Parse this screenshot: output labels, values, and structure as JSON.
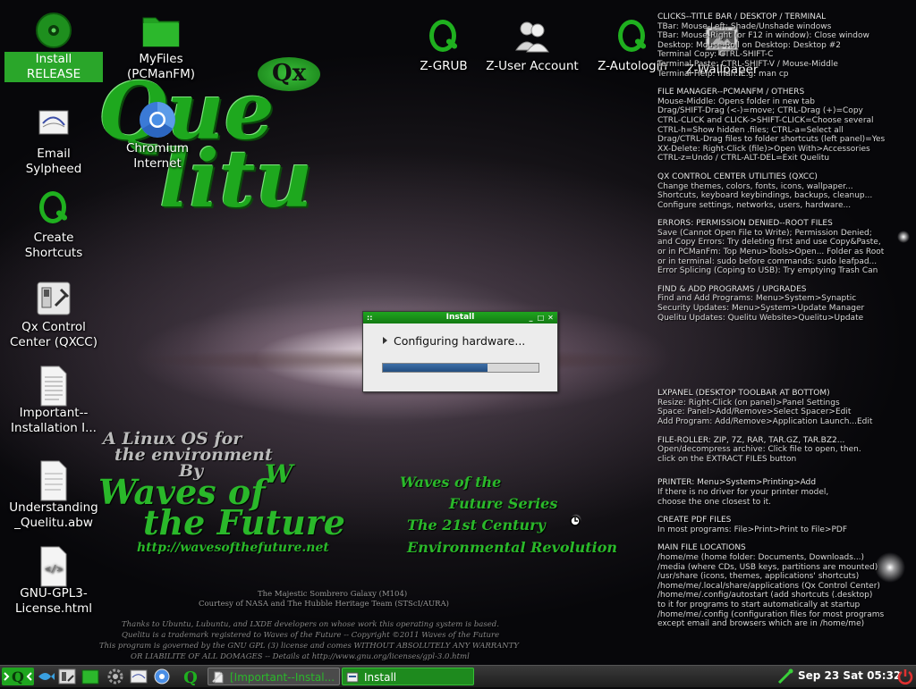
{
  "desktop_icons": [
    {
      "label": "Install RELEASE",
      "icon": "install-disc-icon"
    },
    {
      "label": "MyFiles (PCManFM)",
      "icon": "folder-icon"
    },
    {
      "label": "Email Sylpheed",
      "icon": "email-icon"
    },
    {
      "label": "Chromium Internet",
      "icon": "chromium-icon"
    },
    {
      "label": "Create Shortcuts",
      "icon": "q-icon"
    },
    {
      "label": "Qx Control Center (QXCC)",
      "icon": "control-center-icon"
    },
    {
      "label": "Important--Installation I...",
      "icon": "text-file-icon"
    },
    {
      "label": "Understanding _Quelitu.abw",
      "icon": "document-icon"
    },
    {
      "label": "GNU-GPL3-License.html",
      "icon": "html-file-icon"
    },
    {
      "label": "Z-GRUB",
      "icon": "q-icon"
    },
    {
      "label": "Z-User Account",
      "icon": "users-icon"
    },
    {
      "label": "Z-Autologin",
      "icon": "q-icon"
    },
    {
      "label": "Z-Wallpaper",
      "icon": "wallpaper-icon"
    }
  ],
  "wallpaper": {
    "logo_que": "Que",
    "logo_litu": "litu",
    "logo_badge": "Qx",
    "tagline_1": "A Linux OS for",
    "tagline_2": "the environment",
    "tagline_3": "By",
    "brand_1": "Waves of",
    "brand_2": "the Future",
    "brand_w": "W",
    "url": "http://wavesofthefuture.net",
    "series_1": "Waves of the",
    "series_2": "Future Series",
    "series_3": "The 21st Century",
    "series_4": "Environmental Revolution",
    "credit_1": "The Majestic Sombrero Galaxy (M104)",
    "credit_2": "Courtesy of NASA and The Hubble Heritage Team (STScI/AURA)",
    "footer_1": "Thanks to Ubuntu, Lubuntu, and LXDE developers on whose work this operating system is based.",
    "footer_2": "Quelitu is a trademark registered to Waves of the Future  --  Copyright ©2011  Waves of the Future",
    "footer_3": "This program is governed by the GNU GPL (3) license and comes WITHOUT ABSOLUTELY ANY WARRANTY",
    "footer_4": "OR LIABILITE OF ALL DOMAGES -- Details at http://www.gnu.org/licenses/gpl-3.0.html"
  },
  "info_panel": [
    {
      "title": "CLICKS--TITLE BAR / DESKTOP / TERMINAL",
      "lines": [
        "TBar: Mouse-Left: Shade/Unshade windows",
        "TBar: Mouse-Right (or F12 in window): Close window",
        "Desktop: Mouse-Roll on Desktop: Desktop #2",
        "Terminal Copy: CTRL-SHIFT-C",
        "Terminal Paste: CTRL-SHIFT-V / Mouse-Middle",
        "Terminal Help: man. E.g. man cp"
      ]
    },
    {
      "title": "FILE MANAGER--PCMANFM / OTHERS",
      "lines": [
        "Mouse-Middle: Opens folder in new tab",
        "Drag/SHIFT-Drag (<-)=move; CTRL-Drag (+)=Copy",
        "CTRL-CLICK and CLICK->SHIFT-CLICK=Choose several",
        "CTRL-h=Show hidden .files; CTRL-a=Select all",
        "Drag/CTRL-Drag files to folder shortcuts (left panel)=Yes",
        "XX-Delete: Right-Click (file)>Open With>Accessories",
        "CTRL-z=Undo / CTRL-ALT-DEL=Exit Quelitu"
      ]
    },
    {
      "title": "QX CONTROL CENTER UTILITIES (QXCC)",
      "lines": [
        "Change themes, colors, fonts, icons, wallpaper...",
        "Shortcuts, keyboard keybindings, backups, cleanup...",
        "Configure settings, networks, users, hardware..."
      ]
    },
    {
      "title": "ERRORS: PERMISSION DENIED--ROOT FILES",
      "lines": [
        "Save (Cannot Open File to Write); Permission Denied;",
        "and Copy Errors: Try deleting first and use Copy&Paste,",
        "or in PCManFm: Top Menu>Tools>Open... Folder as Root",
        "or in terminal: sudo before commands: sudo leafpad...",
        "Error Splicing (Coping to USB): Try emptying Trash Can"
      ]
    },
    {
      "title": "FIND & ADD PROGRAMS / UPGRADES",
      "lines": [
        "Find and Add Programs: Menu>System>Synaptic",
        "Security Updates: Menu>System>Update Manager",
        "Quelitu Updates: Quelitu Website>Quelitu>Update"
      ]
    },
    {
      "title": "LXPANEL (DESKTOP TOOLBAR AT BOTTOM)",
      "lines": [
        "Resize: Right-Click (on panel)>Panel Settings",
        "Space: Panel>Add/Remove>Select Spacer>Edit",
        "Add Program: Add/Remove>Application Launch...Edit"
      ]
    },
    {
      "title": "FILE-ROLLER: ZIP, 7Z, RAR, TAR.GZ, TAR.BZ2...",
      "lines": [
        "Open/decompress archive: Click file to open, then.",
        "click on the EXTRACT FILES button"
      ]
    },
    {
      "title": "PRINTER: Menu>System>Printing>Add",
      "lines": [
        "If there is no driver for your printer model,",
        "choose the one closest to it."
      ]
    },
    {
      "title": "CREATE PDF FILES",
      "lines": [
        "In most programs: File>Print>Print to File>PDF"
      ]
    },
    {
      "title": "MAIN FILE LOCATIONS",
      "lines": [
        "/home/me (home folder: Documents, Downloads...)",
        "/media (where CDs, USB keys, partitions are mounted)",
        "/usr/share (icons, themes, applications' shortcuts)",
        "/home/me/.local/share/applications (Qx Control Center)",
        "/home/me/.config/autostart (add shortcuts (.desktop)",
        "to it for programs to start automatically at startup",
        "/home/me/.config (configuration files for most programs",
        "except email and browsers which are in /home/me)"
      ]
    }
  ],
  "dialog": {
    "title": "Install",
    "status": "Configuring hardware...",
    "progress": 0.67,
    "minimize": "_",
    "maximize": "□",
    "close": "✕",
    "grip": "::"
  },
  "taskbar": {
    "tasks": [
      {
        "label": "[Important--Instal...",
        "icon": "text-file-icon"
      },
      {
        "label": "Install",
        "icon": "install-icon"
      }
    ],
    "clock": "Sep 23 Sat 05:32"
  },
  "colors": {
    "accent": "#1fa51f",
    "dialog_bg": "#ececec",
    "progress": "#2b5a92",
    "info_text": "#d8d8d8"
  }
}
